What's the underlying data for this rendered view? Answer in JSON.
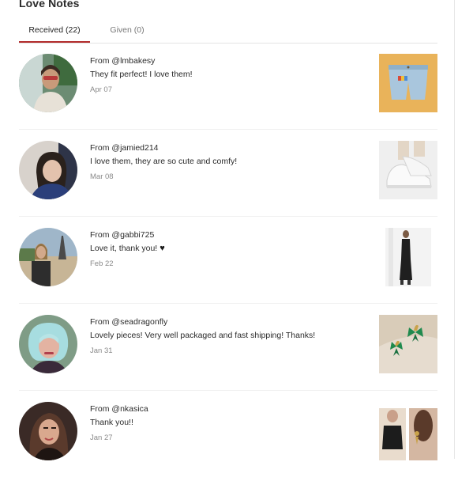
{
  "page": {
    "title": "Love Notes"
  },
  "tabs": [
    {
      "label": "Received (22)",
      "active": true
    },
    {
      "label": "Given (0)",
      "active": false
    }
  ],
  "notes": [
    {
      "from": "From @lmbakesy",
      "message": "They fit perfect! I love them!",
      "date": "Apr 07",
      "avatar_icon": "user-photo",
      "item_icon": "denim-shorts"
    },
    {
      "from": "From @jamied214",
      "message": "I love them, they are so cute and comfy!",
      "date": "Mar 08",
      "avatar_icon": "user-photo",
      "item_icon": "white-sneakers"
    },
    {
      "from": "From @gabbi725",
      "message": "Love it, thank you!",
      "date": "Feb 22",
      "avatar_icon": "user-photo",
      "item_icon": "black-dress",
      "emoji": "black-heart"
    },
    {
      "from": "From @seadragonfly",
      "message": "Lovely pieces! Very well packaged and fast shipping! Thanks!",
      "date": "Jan 31",
      "avatar_icon": "user-photo",
      "item_icon": "butterfly-earrings"
    },
    {
      "from": "From @nkasica",
      "message": "Thank you!!",
      "date": "Jan 27",
      "avatar_icon": "user-photo",
      "item_icon": "black-top-earrings"
    }
  ],
  "colors": {
    "accent": "#b22c2c",
    "muted": "#8a8a8a",
    "divider": "#e3e3e3"
  }
}
